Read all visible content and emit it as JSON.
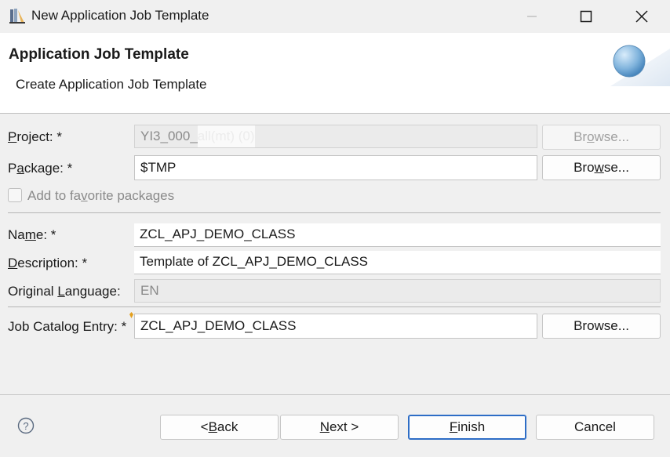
{
  "window": {
    "title": "New Application Job Template",
    "minimize_icon": "minimize-icon",
    "maximize_icon": "maximize-icon",
    "close_icon": "close-icon"
  },
  "header": {
    "title": "Application Job Template",
    "subtitle": "Create Application Job Template"
  },
  "form": {
    "project_label_pre": "",
    "project_label_u": "P",
    "project_label_post": "roject: *",
    "project_value": "YI3_000_",
    "project_value_hidden": "all(mt) (0)",
    "package_label_pre": "P",
    "package_label_u": "a",
    "package_label_post": "ckage: *",
    "package_value": "$TMP",
    "favorite_pre": "Add to fa",
    "favorite_u": "v",
    "favorite_post": "orite packages",
    "name_label_pre": "Na",
    "name_label_u": "m",
    "name_label_post": "e: *",
    "name_value": "ZCL_APJ_DEMO_CLASS",
    "description_label_pre": "",
    "description_label_u": "D",
    "description_label_post": "escription: *",
    "description_value": "Template of ZCL_APJ_DEMO_CLASS",
    "language_label_pre": "Original ",
    "language_label_u": "L",
    "language_label_post": "anguage:",
    "language_value": "EN",
    "catalog_label": "Job Catalog Entry: *",
    "catalog_value": "ZCL_APJ_DEMO_CLASS"
  },
  "buttons": {
    "browse_pre": "Br",
    "browse_u": "o",
    "browse_post": "wse...",
    "browse2_pre": "Bro",
    "browse2_u": "w",
    "browse2_post": "se...",
    "browse3": "Browse...",
    "back_pre": "< ",
    "back_u": "B",
    "back_post": "ack",
    "next_u": "N",
    "next_post": "ext >",
    "finish_u": "F",
    "finish_post": "inish",
    "cancel": "Cancel"
  },
  "help": {
    "icon": "help-icon",
    "glyph": "?"
  },
  "colors": {
    "default_button_border": "#2d6dc6",
    "header_bg": "#ffffff",
    "dialog_bg": "#f0f0f0"
  }
}
